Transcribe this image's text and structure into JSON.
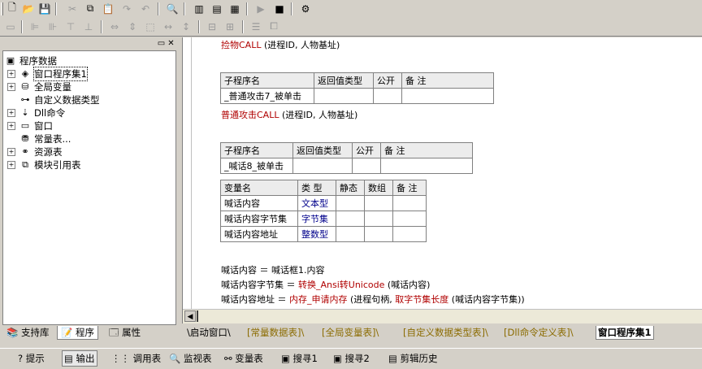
{
  "left_panel": {
    "tree": [
      {
        "label": "程序数据",
        "icon": "database-icon",
        "level": 0,
        "expander": ""
      },
      {
        "label": "窗口程序集1",
        "icon": "layers-icon",
        "level": 1,
        "expander": "+"
      },
      {
        "label": "全局变量",
        "icon": "variable-icon",
        "level": 1,
        "expander": "+"
      },
      {
        "label": "自定义数据类型",
        "icon": "datatype-icon",
        "level": 1,
        "expander": ""
      },
      {
        "label": "Dll命令",
        "icon": "dll-icon",
        "level": 1,
        "expander": "+"
      },
      {
        "label": "窗口",
        "icon": "window-icon",
        "level": 1,
        "expander": "+"
      },
      {
        "label": "常量表...",
        "icon": "constant-icon",
        "level": 1,
        "expander": ""
      },
      {
        "label": "资源表",
        "icon": "resource-icon",
        "level": 1,
        "expander": "+"
      },
      {
        "label": "模块引用表",
        "icon": "module-icon",
        "level": 1,
        "expander": "+"
      }
    ],
    "tabs": {
      "support": "支持库",
      "program": "程序",
      "properties": "属性"
    }
  },
  "editor": {
    "line_pickup": {
      "name": "捡物CALL",
      "args": " (进程ID, 人物基址)"
    },
    "table1": {
      "headers": [
        "子程序名",
        "返回值类型",
        "公开",
        "备 注"
      ],
      "row": [
        "_普通攻击7_被单击",
        "",
        "",
        ""
      ]
    },
    "line_attack": {
      "name": "普通攻击CALL",
      "args": " (进程ID, 人物基址)"
    },
    "table2": {
      "headers": [
        "子程序名",
        "返回值类型",
        "公开",
        "备 注"
      ],
      "row": [
        "_喊话8_被单击",
        "",
        "",
        ""
      ]
    },
    "var_table": {
      "headers": [
        "变量名",
        "类 型",
        "静态",
        "数组",
        "备 注"
      ],
      "rows": [
        {
          "name": "喊话内容",
          "type": "文本型"
        },
        {
          "name": "喊话内容字节集",
          "type": "字节集"
        },
        {
          "name": "喊话内容地址",
          "type": "整数型"
        }
      ]
    },
    "code": {
      "l1_a": "喊话内容 ＝ 喊话框1.内容",
      "l2_a": "喊话内容字节集 ＝ ",
      "l2_b": "转换_Ansi转Unicode",
      "l2_c": " (喊话内容)",
      "l3_a": "喊话内容地址 ＝ ",
      "l3_b": "内存_申请内存",
      "l3_c": " (进程句柄, ",
      "l3_d": "取字节集长度",
      "l3_e": " (喊话内容字节集))"
    }
  },
  "editor_tabs": [
    "启动窗口",
    "[常量数据表]",
    "[全局变量表]",
    "[自定义数据类型表]",
    "[Dll命令定义表]",
    "窗口程序集1"
  ],
  "bottom_tabs": [
    "提示",
    "输出",
    "调用表",
    "监视表",
    "变量表",
    "搜寻1",
    "搜寻2",
    "剪辑历史"
  ],
  "colors": {
    "inactive_tab": "#8b6b00",
    "code_red": "#b00000",
    "code_blue": "#00008b"
  }
}
